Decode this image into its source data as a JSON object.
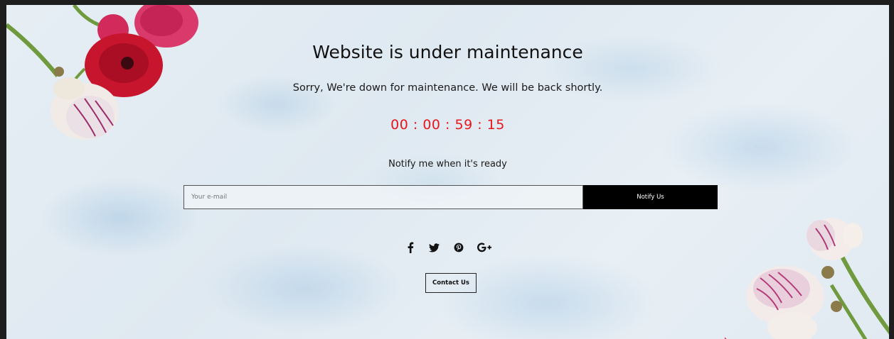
{
  "page": {
    "title": "Website is under maintenance",
    "subtitle": "Sorry, We're down for maintenance. We will be back shortly.",
    "countdown": "00 : 00 : 59 : 15",
    "notify_text": "Notify me when it's ready"
  },
  "form": {
    "email_placeholder": "Your e-mail",
    "email_value": "",
    "notify_button": "Notify Us"
  },
  "social": [
    {
      "name": "facebook-icon",
      "glyph": "f"
    },
    {
      "name": "twitter-icon",
      "glyph": "twitter"
    },
    {
      "name": "pinterest-icon",
      "glyph": "pinterest"
    },
    {
      "name": "google-plus-icon",
      "glyph": "G+"
    }
  ],
  "contact_button": "Contact Us",
  "colors": {
    "countdown": "#e8151c",
    "button_bg": "#000000",
    "frame": "#1e1e1e"
  }
}
